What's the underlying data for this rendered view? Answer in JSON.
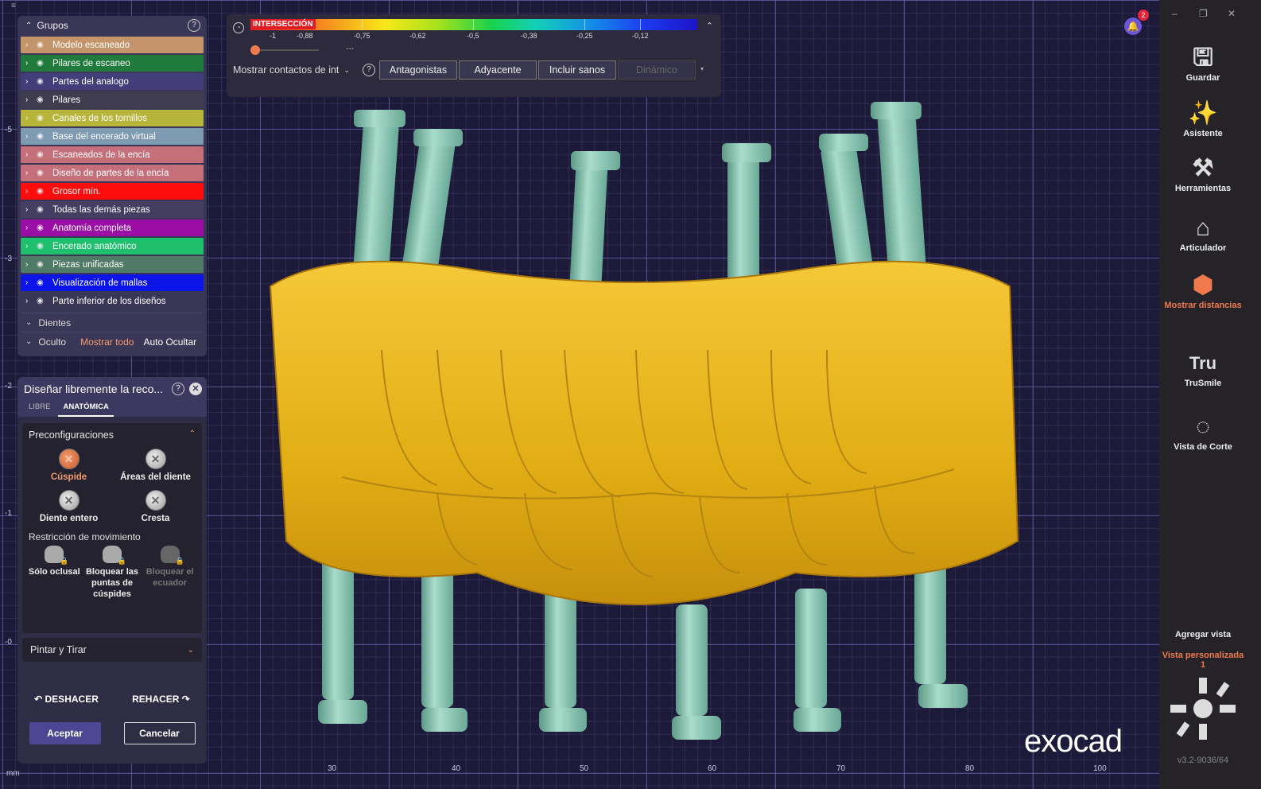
{
  "title_bar_icon": "≡",
  "unit": "mm",
  "axes": {
    "x_ticks": [
      "30",
      "40",
      "50",
      "60",
      "70",
      "80",
      "100"
    ],
    "y_ticks": [
      "-5",
      "-3",
      "-2",
      "-1",
      "-0"
    ]
  },
  "groups_panel": {
    "title": "Grupos",
    "help": "?",
    "items": [
      {
        "label": "Modelo escaneado",
        "color": "#c4956a"
      },
      {
        "label": "Pilares de escaneo",
        "color": "#1f7a3c"
      },
      {
        "label": "Partes del analogo",
        "color": "#433e7a"
      },
      {
        "label": "Pilares",
        "color": "#403c50"
      },
      {
        "label": "Canales de los tornillos",
        "color": "#b8b33a"
      },
      {
        "label": "Base del encerado virtual",
        "color": "#7f9ab3"
      },
      {
        "label": "Escaneados de la encía",
        "color": "#c46f79"
      },
      {
        "label": "Diseño de partes de la encía",
        "color": "#c46f79"
      },
      {
        "label": "Grosor mín.",
        "color": "#ff0d0d"
      },
      {
        "label": "Todas las demás piezas",
        "color": "#433e62"
      },
      {
        "label": "Anatomía completa",
        "color": "#9a0ea6"
      },
      {
        "label": "Encerado anatómico",
        "color": "#1fbf6e"
      },
      {
        "label": "Piezas unificadas",
        "color": "#4f7a67"
      },
      {
        "label": "Visualización de mallas",
        "color": "#0c14e8"
      },
      {
        "label": "Parte inferior de los diseños",
        "color": "#3a3656"
      }
    ],
    "teeth_label": "Dientes",
    "hidden_label": "Oculto",
    "show_all": "Mostrar todo",
    "auto_hide": "Auto Ocultar"
  },
  "design_panel": {
    "title": "Diseñar libremente la reco...",
    "tabs": [
      "LIBRE",
      "ANATÓMICA"
    ],
    "active_tab": "ANATÓMICA",
    "presets_title": "Preconfiguraciones",
    "presets": [
      "Cúspide",
      "Áreas del diente",
      "Diente entero",
      "Cresta"
    ],
    "selected_preset": "Cúspide",
    "restriction_title": "Restricción de movimiento",
    "restrictions": [
      {
        "label": "Sólo oclusal",
        "enabled": true
      },
      {
        "label": "Bloquear las puntas de cúspides",
        "enabled": true
      },
      {
        "label": "Bloquear el ecuador",
        "enabled": false
      }
    ],
    "paint_title": "Pintar y Tirar",
    "undo": "DESHACER",
    "redo": "REHACER",
    "accept": "Aceptar",
    "cancel": "Cancelar"
  },
  "toolbar": {
    "colorbar_label": "INTERSECCIÓN",
    "colorbar_ticks": [
      "-1",
      "-0,88",
      "-0,75",
      "-0,62",
      "-0,5",
      "-0,38",
      "-0,25",
      "-0,12"
    ],
    "slider_value": "---",
    "contacts_select": "Mostrar contactos de int",
    "buttons": [
      {
        "label": "Antagonistas",
        "enabled": true
      },
      {
        "label": "Adyacente",
        "enabled": true
      },
      {
        "label": "Incluir sanos",
        "enabled": true
      },
      {
        "label": "Dinámico",
        "enabled": false
      }
    ]
  },
  "notifications": {
    "count": "2"
  },
  "sidebar": {
    "items": [
      {
        "label": "Guardar",
        "icon": "save-icon",
        "active": false
      },
      {
        "label": "Asistente",
        "icon": "wand-icon",
        "active": false
      },
      {
        "label": "Herramientas",
        "icon": "tools-icon",
        "active": false
      },
      {
        "label": "Articulador",
        "icon": "articulator-icon",
        "active": false
      },
      {
        "label": "Mostrar distancias",
        "icon": "distances-icon",
        "active": true
      },
      {
        "label": "TruSmile",
        "icon": "trusmile-icon",
        "active": false
      },
      {
        "label": "Vista de Corte",
        "icon": "cut-view-icon",
        "active": false
      }
    ],
    "add_view": "Agregar vista",
    "custom_view": "Vista personalizada 1",
    "version": "v3.2-9036/64"
  },
  "logo_text": "exocad",
  "colors": {
    "accent": "#f07a4d",
    "crown": "#e7b61e",
    "abutment": "#8cc9b6",
    "grid_bg": "#1c1a38"
  }
}
